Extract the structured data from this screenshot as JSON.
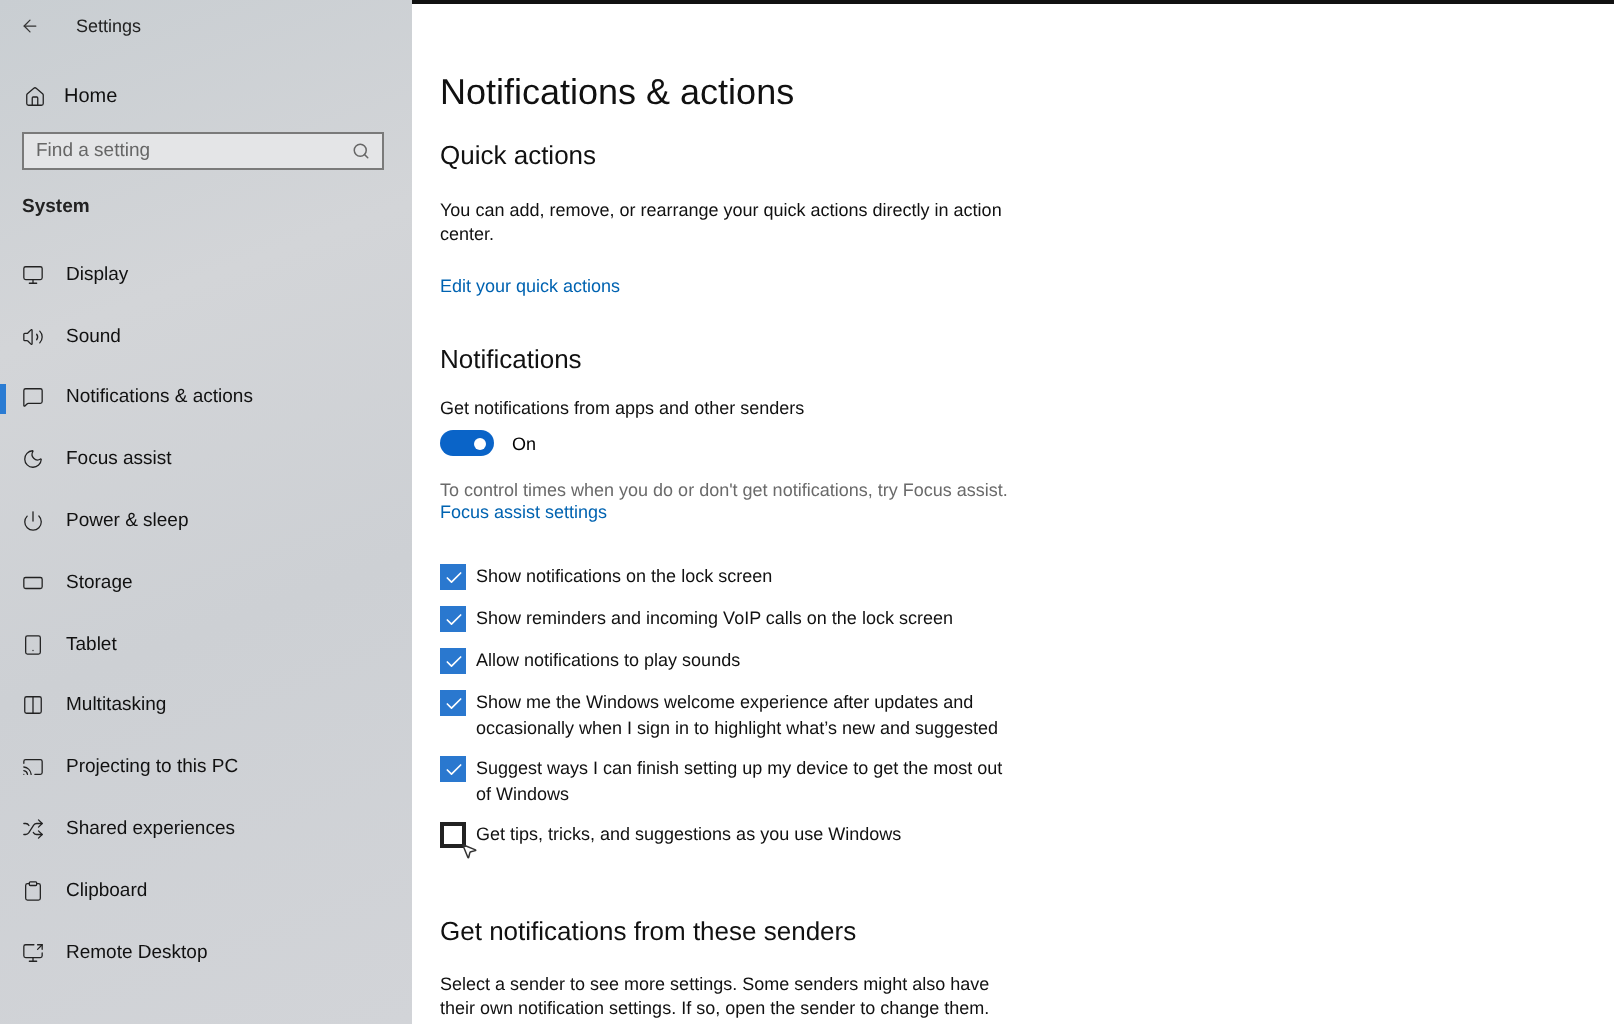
{
  "window": {
    "title": "Settings"
  },
  "sidebar": {
    "home": "Home",
    "search": {
      "placeholder": "Find a setting"
    },
    "section": "System",
    "items": [
      {
        "label": "Display",
        "selected": false
      },
      {
        "label": "Sound",
        "selected": false
      },
      {
        "label": "Notifications & actions",
        "selected": true
      },
      {
        "label": "Focus assist",
        "selected": false
      },
      {
        "label": "Power & sleep",
        "selected": false
      },
      {
        "label": "Storage",
        "selected": false
      },
      {
        "label": "Tablet",
        "selected": false
      },
      {
        "label": "Multitasking",
        "selected": false
      },
      {
        "label": "Projecting to this PC",
        "selected": false
      },
      {
        "label": "Shared experiences",
        "selected": false
      },
      {
        "label": "Clipboard",
        "selected": false
      },
      {
        "label": "Remote Desktop",
        "selected": false
      }
    ]
  },
  "page": {
    "title": "Notifications & actions",
    "quick_actions": {
      "heading": "Quick actions",
      "text": "You can add, remove, or rearrange your quick actions directly in action center.",
      "link": "Edit your quick actions"
    },
    "notifications": {
      "heading": "Notifications",
      "toggle_label": "Get notifications from apps and other senders",
      "toggle": {
        "on": true,
        "state": "On"
      },
      "hint": "To control times when you do or don't get notifications, try Focus assist.",
      "link": "Focus assist settings",
      "options": [
        {
          "label": "Show notifications on the lock screen",
          "checked": true
        },
        {
          "label": "Show reminders and incoming VoIP calls on the lock screen",
          "checked": true
        },
        {
          "label": "Allow notifications to play sounds",
          "checked": true
        },
        {
          "label": "Show me the Windows welcome experience after updates and occasionally when I sign in to highlight what’s new and suggested",
          "checked": true
        },
        {
          "label": "Suggest ways I can finish setting up my device to get the most out of Windows",
          "checked": true
        },
        {
          "label": "Get tips, tricks, and suggestions as you use Windows",
          "checked": false
        }
      ]
    },
    "senders": {
      "heading": "Get notifications from these senders",
      "text": "Select a sender to see more settings. Some senders might also have their own notification settings. If so, open the sender to change them."
    }
  }
}
